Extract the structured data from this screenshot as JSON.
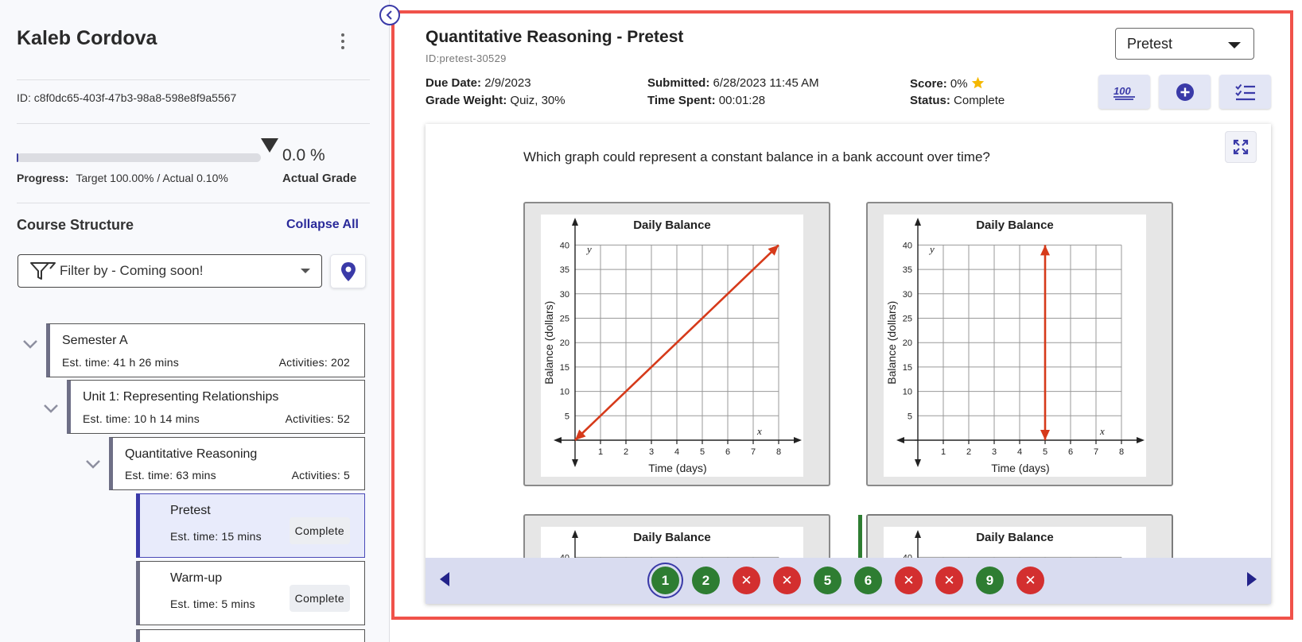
{
  "sidebar": {
    "student_name": "Kaleb Cordova",
    "student_id": "ID: c8f0dc65-403f-47b3-98a8-598e8f9a5567",
    "progress": {
      "label": "Progress:",
      "text": "Target 100.00% / Actual 0.10%",
      "actual_fraction": 0.001,
      "grade_value": "0.0 %",
      "grade_label": "Actual Grade"
    },
    "course_structure_title": "Course Structure",
    "collapse_all_label": "Collapse All",
    "filter_placeholder": "Filter by - Coming soon!",
    "tree": [
      {
        "title": "Semester A",
        "est": "Est. time: 41 h 26 mins",
        "activities": "Activities: 202"
      },
      {
        "title": "Unit 1: Representing Relationships",
        "est": "Est. time: 10 h 14 mins",
        "activities": "Activities: 52"
      },
      {
        "title": "Quantitative Reasoning",
        "est": "Est. time: 63 mins",
        "activities": "Activities: 5"
      },
      {
        "title": "Pretest",
        "est": "Est. time: 15 mins",
        "status": "Complete"
      },
      {
        "title": "Warm-up",
        "est": "Est. time: 5 mins",
        "status": "Complete"
      }
    ]
  },
  "activity": {
    "title": "Quantitative Reasoning - Pretest",
    "id": "ID:pretest-30529",
    "due_date_label": "Due Date:",
    "due_date": "2/9/2023",
    "grade_weight_label": "Grade Weight:",
    "grade_weight": "Quiz, 30%",
    "submitted_label": "Submitted:",
    "submitted": "6/28/2023 11:45 AM",
    "time_spent_label": "Time Spent:",
    "time_spent": "00:01:28",
    "score_label": "Score:",
    "score": "0%",
    "status_label": "Status:",
    "status": "Complete",
    "select_value": "Pretest",
    "hundred_icon_text": "100"
  },
  "question": {
    "text": "Which graph could represent a constant balance in a bank account over time?",
    "graph_title": "Daily Balance",
    "y_axis_label": "Balance (dollars)",
    "x_axis_label": "Time (days)",
    "y_var": "y",
    "x_var": "x",
    "x_ticks": [
      "1",
      "2",
      "3",
      "4",
      "5",
      "6",
      "7",
      "8"
    ],
    "y_ticks": [
      "5",
      "10",
      "15",
      "20",
      "25",
      "30",
      "35",
      "40"
    ],
    "option_a": {
      "line_from": [
        0,
        0
      ],
      "line_to": [
        8,
        40
      ]
    },
    "option_b": {
      "line_x": 5,
      "y_from": 0,
      "y_to": 40
    }
  },
  "navigation": {
    "questions": [
      {
        "label": "1",
        "state": "correct",
        "current": true
      },
      {
        "label": "2",
        "state": "correct"
      },
      {
        "label": "✕",
        "state": "incorrect"
      },
      {
        "label": "✕",
        "state": "incorrect"
      },
      {
        "label": "5",
        "state": "correct"
      },
      {
        "label": "6",
        "state": "correct"
      },
      {
        "label": "✕",
        "state": "incorrect"
      },
      {
        "label": "✕",
        "state": "incorrect"
      },
      {
        "label": "9",
        "state": "correct"
      },
      {
        "label": "✕",
        "state": "incorrect"
      }
    ]
  },
  "colors": {
    "accent": "#3a3aa8",
    "correct": "#2e7d32",
    "incorrect": "#d32f2f",
    "graph_line": "#d63a1a",
    "highlight": "#f0524a"
  }
}
